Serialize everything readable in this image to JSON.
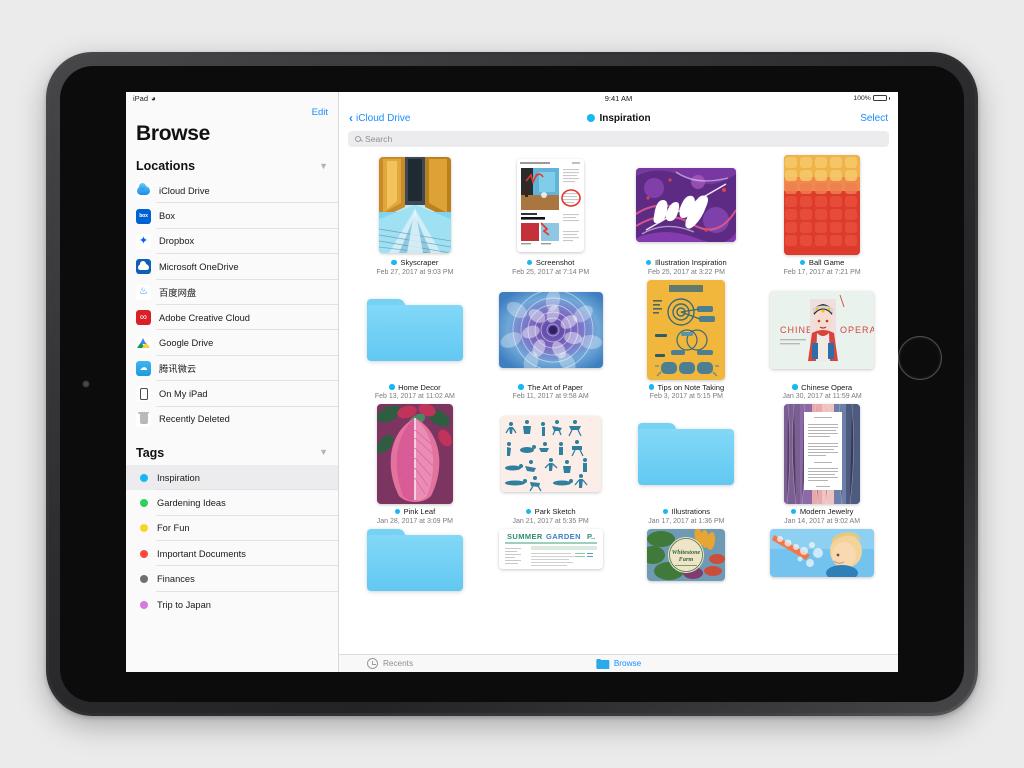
{
  "device": {
    "model": "iPad",
    "frame_color": "#2c2c2e"
  },
  "status_bar": {
    "carrier_label": "iPad",
    "wifi_icon": "wifi-icon",
    "time": "9:41 AM",
    "battery_percent": "100%"
  },
  "sidebar": {
    "edit_label": "Edit",
    "title": "Browse",
    "sections": [
      {
        "title": "Locations",
        "collapse_icon": "chevron-down-icon",
        "items": [
          {
            "label": "iCloud Drive",
            "icon": "icloud-drive-icon"
          },
          {
            "label": "Box",
            "icon": "box-icon"
          },
          {
            "label": "Dropbox",
            "icon": "dropbox-icon"
          },
          {
            "label": "Microsoft OneDrive",
            "icon": "onedrive-icon"
          },
          {
            "label": "百度网盘",
            "icon": "baidu-netdisk-icon"
          },
          {
            "label": "Adobe Creative Cloud",
            "icon": "adobe-creative-cloud-icon"
          },
          {
            "label": "Google Drive",
            "icon": "google-drive-icon"
          },
          {
            "label": "腾讯微云",
            "icon": "tencent-weiyun-icon"
          },
          {
            "label": "On My iPad",
            "icon": "ipad-device-icon"
          },
          {
            "label": "Recently Deleted",
            "icon": "trash-icon"
          }
        ]
      },
      {
        "title": "Tags",
        "collapse_icon": "chevron-down-icon",
        "items": [
          {
            "label": "Inspiration",
            "color": "#17b7f5",
            "selected": true
          },
          {
            "label": "Gardening Ideas",
            "color": "#2ed15e",
            "selected": false
          },
          {
            "label": "For Fun",
            "color": "#fdd226",
            "selected": false
          },
          {
            "label": "Important Documents",
            "color": "#fc4a3c",
            "selected": false
          },
          {
            "label": "Finances",
            "color": "#6e6e73",
            "selected": false
          },
          {
            "label": "Trip to Japan",
            "color": "#d97ae0",
            "selected": false
          }
        ]
      }
    ]
  },
  "main": {
    "back_label": "iCloud Drive",
    "back_icon": "chevron-left-icon",
    "title": "Inspiration",
    "title_tag_color": "#17b7f5",
    "select_label": "Select",
    "search_placeholder": "Search",
    "search_icon": "search-icon",
    "items": [
      {
        "name": "Skyscraper",
        "subtitle": "Feb 27, 2017 at 9:03 PM",
        "kind": "image",
        "tag_color": "#17b7f5"
      },
      {
        "name": "Screenshot",
        "subtitle": "Feb 25, 2017 at 7:14 PM",
        "kind": "image",
        "tag_color": "#17b7f5"
      },
      {
        "name": "Illustration Inspiration",
        "subtitle": "Feb 25, 2017 at 3:22 PM",
        "kind": "image",
        "tag_color": "#17b7f5"
      },
      {
        "name": "Ball Game",
        "subtitle": "Feb 17, 2017 at 7:21 PM",
        "kind": "image",
        "tag_color": "#17b7f5"
      },
      {
        "name": "Home Decor",
        "subtitle": "Feb 13, 2017 at 11:02 AM",
        "kind": "folder",
        "tag_color": "#17b7f5"
      },
      {
        "name": "The Art of Paper",
        "subtitle": "Feb 11, 2017 at 9:58 AM",
        "kind": "image",
        "tag_color": "#17b7f5"
      },
      {
        "name": "Tips on Note Taking",
        "subtitle": "Feb 3, 2017 at 5:15 PM",
        "kind": "image",
        "tag_color": "#17b7f5"
      },
      {
        "name": "Chinese Opera",
        "subtitle": "Jan 30, 2017 at 11:59 AM",
        "kind": "image",
        "tag_color": "#17b7f5"
      },
      {
        "name": "Pink Leaf",
        "subtitle": "Jan 28, 2017 at 3:09 PM",
        "kind": "image",
        "tag_color": "#17b7f5"
      },
      {
        "name": "Park Sketch",
        "subtitle": "Jan 21, 2017 at 5:35 PM",
        "kind": "image",
        "tag_color": "#17b7f5"
      },
      {
        "name": "Illustrations",
        "subtitle": "Jan 17, 2017 at 1:36 PM",
        "kind": "folder",
        "tag_color": "#17b7f5"
      },
      {
        "name": "Modern Jewelry",
        "subtitle": "Jan 14, 2017 at 9:02 AM",
        "kind": "image",
        "tag_color": "#17b7f5"
      }
    ],
    "partial_row": [
      {
        "kind": "folder"
      },
      {
        "kind": "image",
        "title": "SUMMER GARDEN PARTY"
      },
      {
        "kind": "image",
        "title": "Whitestone Farm"
      },
      {
        "kind": "image"
      }
    ]
  },
  "tab_bar": {
    "tabs": [
      {
        "label": "Recents",
        "icon": "clock-icon",
        "active": false
      },
      {
        "label": "Browse",
        "icon": "folder-icon",
        "active": true
      }
    ]
  }
}
